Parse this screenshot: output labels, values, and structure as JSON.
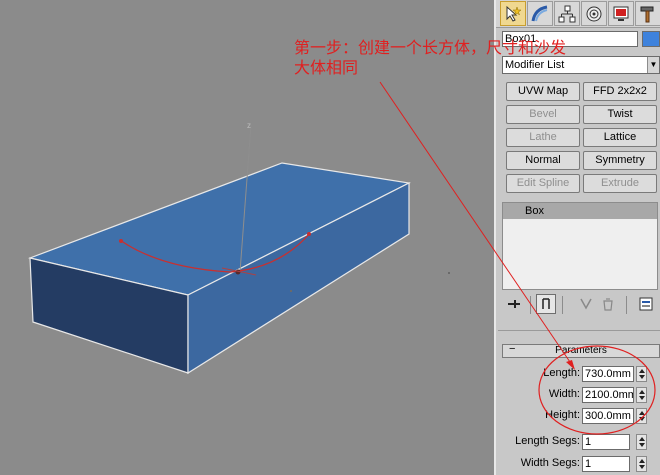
{
  "annotation": {
    "line1": "第一步：创建一个长方体，尺寸和沙发",
    "line2": "大体相同",
    "color": "#e02020"
  },
  "viewport": {
    "background": "#8b8b8b",
    "object_color": "#3d6ea8",
    "axis_label": "z"
  },
  "command_panel": {
    "tabs": [
      {
        "name": "create",
        "icon": "cursor-star-icon"
      },
      {
        "name": "modify",
        "icon": "bend-arc-icon"
      },
      {
        "name": "hierarchy",
        "icon": "hierarchy-icon"
      },
      {
        "name": "motion",
        "icon": "motion-icon"
      },
      {
        "name": "display",
        "icon": "display-icon"
      },
      {
        "name": "utilities",
        "icon": "hammer-icon"
      }
    ],
    "object_name": "Box01",
    "object_color": "#3e82dc",
    "modifier_list": "Modifier List",
    "modifier_buttons": [
      {
        "label": "UVW Map",
        "enabled": true
      },
      {
        "label": "FFD 2x2x2",
        "enabled": true
      },
      {
        "label": "Bevel",
        "enabled": false
      },
      {
        "label": "Twist",
        "enabled": true
      },
      {
        "label": "Lathe",
        "enabled": false
      },
      {
        "label": "Lattice",
        "enabled": true
      },
      {
        "label": "Normal",
        "enabled": true
      },
      {
        "label": "Symmetry",
        "enabled": true
      },
      {
        "label": "Edit Spline",
        "enabled": false
      },
      {
        "label": "Extrude",
        "enabled": false
      }
    ],
    "stack_entry": "Box",
    "parameters": {
      "title": "Parameters",
      "rows": [
        {
          "label": "Length:",
          "value": "730.0mm"
        },
        {
          "label": "Width:",
          "value": "2100.0mm"
        },
        {
          "label": "Height:",
          "value": "300.0mm"
        },
        {
          "label": "Length Segs:",
          "value": "1"
        },
        {
          "label": "Width Segs:",
          "value": "1"
        }
      ]
    }
  }
}
